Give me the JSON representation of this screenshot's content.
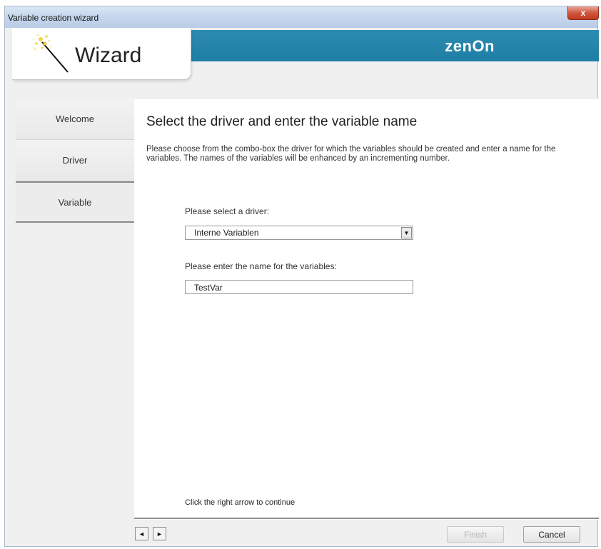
{
  "window": {
    "title": "Variable creation wizard",
    "close_glyph": "x"
  },
  "header": {
    "logo_text": "Wizard",
    "brand": "zenOn",
    "brand_color": "#1f7ea5",
    "logo_icon": "magic-wand-icon"
  },
  "nav": {
    "items": [
      {
        "label": "Welcome"
      },
      {
        "label": "Driver"
      },
      {
        "label": "Variable"
      }
    ],
    "active_index": 2
  },
  "main": {
    "title": "Select the driver and enter the variable name",
    "description": "Please choose from the combo-box the driver for which the variables should be created and enter a name for the variables. The names of the variables will be enhanced by an incrementing number.",
    "driver_label": "Please select a driver:",
    "driver_value": "Interne Variablen",
    "name_label": "Please enter the name for the variables:",
    "name_value": "TestVar",
    "hint": "Click the right arrow to continue"
  },
  "footer": {
    "prev_glyph": "◄",
    "next_glyph": "►",
    "finish_label": "Finish",
    "cancel_label": "Cancel"
  }
}
